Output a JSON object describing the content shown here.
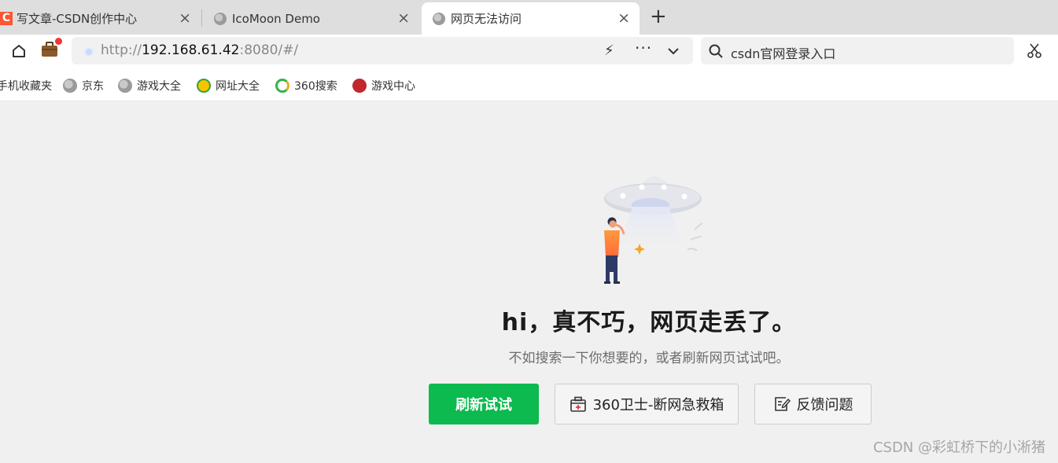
{
  "tabs": [
    {
      "title": "写文章-CSDN创作中心",
      "favicon_text": "C",
      "active": false
    },
    {
      "title": "IcoMoon Demo",
      "active": false
    },
    {
      "title": "网页无法访问",
      "active": true
    }
  ],
  "icons": {
    "tab_close": "×",
    "new_tab": "+",
    "bolt": "⚡",
    "more": "···"
  },
  "address_bar": {
    "scheme": "http://",
    "host": "192.168.61.42",
    "path": ":8080/#/"
  },
  "search_box": {
    "text": "csdn官网登录入口"
  },
  "bookmarks": [
    "手机收藏夹",
    "京东",
    "游戏大全",
    "网址大全",
    "360搜索",
    "游戏中心"
  ],
  "error_page": {
    "headline": "hi，真不巧，网页走丢了。",
    "subtext": "不如搜索一下你想要的，或者刷新网页试试吧。",
    "refresh_label": "刷新试试",
    "guard_label": "360卫士-断网急救箱",
    "feedback_label": "反馈问题"
  },
  "watermark": "CSDN @彩虹桥下的小淅猪",
  "colors": {
    "primary_button": "#0cba4f",
    "csdn_brand": "#fc5531",
    "notification_dot": "#f03535"
  }
}
